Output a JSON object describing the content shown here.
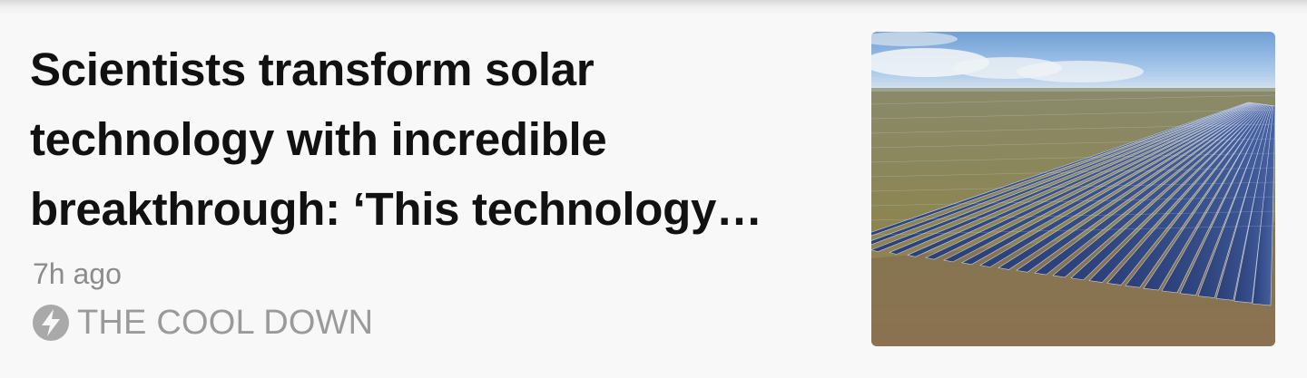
{
  "article": {
    "headline": "Scientists transform solar technology with incredible breakthrough: ‘This technology…",
    "timestamp": "7h ago",
    "source_name": "THE COOL DOWN",
    "source_icon": "lightning-bolt-icon",
    "thumbnail_subject": "solar-farm-photo"
  },
  "colors": {
    "headline": "#111111",
    "meta_text": "#8c8c8c",
    "background": "#f8f8f8"
  }
}
